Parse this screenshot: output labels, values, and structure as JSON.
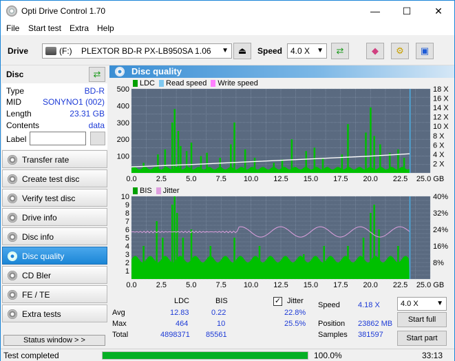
{
  "window": {
    "title": "Opti Drive Control 1.70",
    "minimize": "—",
    "maximize": "☐",
    "close": "✕"
  },
  "menu": [
    "File",
    "Start test",
    "Extra",
    "Help"
  ],
  "toolbar": {
    "drive_label": "Drive",
    "drive_letter": "(F:)",
    "drive_name": "PLEXTOR BD-R  PX-LB950SA 1.06",
    "speed_label": "Speed",
    "speed_value": "4.0 X"
  },
  "disc": {
    "header": "Disc",
    "rows": [
      {
        "label": "Type",
        "value": "BD-R"
      },
      {
        "label": "MID",
        "value": "SONYNO1 (002)"
      },
      {
        "label": "Length",
        "value": "23.31 GB"
      },
      {
        "label": "Contents",
        "value": "data"
      }
    ],
    "label_field": "Label",
    "label_value": ""
  },
  "nav": [
    {
      "label": "Transfer rate",
      "active": false
    },
    {
      "label": "Create test disc",
      "active": false
    },
    {
      "label": "Verify test disc",
      "active": false
    },
    {
      "label": "Drive info",
      "active": false
    },
    {
      "label": "Disc info",
      "active": false
    },
    {
      "label": "Disc quality",
      "active": true
    },
    {
      "label": "CD Bler",
      "active": false
    },
    {
      "label": "FE / TE",
      "active": false
    },
    {
      "label": "Extra tests",
      "active": false
    }
  ],
  "status_window_button": "Status window > >",
  "panel_title": "Disc quality",
  "chart_data": [
    {
      "type": "area",
      "legend": [
        "LDC",
        "Read speed",
        "Write speed"
      ],
      "colors": {
        "LDC": "#00c000",
        "Read speed": "#7ec8f0",
        "Write speed": "#ff80ff",
        "background": "#5a6a80",
        "grid": "#8a9ab0"
      },
      "y_left_ticks": [
        "500",
        "400",
        "300",
        "200",
        "100"
      ],
      "y_right_ticks": [
        "18 X",
        "16 X",
        "14 X",
        "12 X",
        "10 X",
        "8 X",
        "6 X",
        "4 X",
        "2 X"
      ],
      "x_ticks": [
        "0.0",
        "2.5",
        "5.0",
        "7.5",
        "10.0",
        "12.5",
        "15.0",
        "17.5",
        "20.0",
        "22.5",
        "25.0 GB"
      ],
      "xlim": [
        0,
        25
      ],
      "ylim": [
        0,
        500
      ],
      "y2lim": [
        0,
        18
      ],
      "end_position_gb": 23.31,
      "ldc_spikes": [
        [
          1.0,
          60
        ],
        [
          2.2,
          110
        ],
        [
          2.8,
          140
        ],
        [
          3.4,
          300
        ],
        [
          3.6,
          380
        ],
        [
          3.9,
          250
        ],
        [
          4.1,
          160
        ],
        [
          4.6,
          130
        ],
        [
          5.0,
          180
        ],
        [
          5.8,
          100
        ],
        [
          6.3,
          120
        ],
        [
          7.4,
          90
        ],
        [
          8.3,
          170
        ],
        [
          8.6,
          300
        ],
        [
          9.5,
          140
        ],
        [
          10.3,
          90
        ],
        [
          11.9,
          60
        ],
        [
          12.6,
          80
        ],
        [
          13.4,
          200
        ],
        [
          14.6,
          130
        ],
        [
          15.3,
          150
        ],
        [
          16.0,
          90
        ],
        [
          17.6,
          110
        ],
        [
          18.1,
          290
        ],
        [
          19.6,
          240
        ],
        [
          20.0,
          390
        ],
        [
          20.3,
          220
        ],
        [
          20.8,
          170
        ],
        [
          21.6,
          120
        ],
        [
          22.3,
          140
        ],
        [
          22.8,
          90
        ]
      ],
      "ldc_base": 20,
      "read_speed": [
        [
          0,
          1.3
        ],
        [
          5,
          1.8
        ],
        [
          10,
          2.4
        ],
        [
          15,
          3.0
        ],
        [
          20,
          3.6
        ],
        [
          23.3,
          4.1
        ]
      ]
    },
    {
      "type": "area",
      "legend": [
        "BIS",
        "Jitter"
      ],
      "colors": {
        "BIS": "#00c000",
        "Jitter": "#e0a0e0",
        "background": "#5a6a80",
        "grid": "#8a9ab0"
      },
      "y_left_ticks": [
        "10",
        "9",
        "8",
        "7",
        "6",
        "5",
        "4",
        "3",
        "2",
        "1"
      ],
      "y_right_ticks": [
        "40%",
        "32%",
        "24%",
        "16%",
        "8%"
      ],
      "x_ticks": [
        "0.0",
        "2.5",
        "5.0",
        "7.5",
        "10.0",
        "12.5",
        "15.0",
        "17.5",
        "20.0",
        "22.5",
        "25.0 GB"
      ],
      "xlim": [
        0,
        25
      ],
      "ylim": [
        0,
        10
      ],
      "y2lim": [
        0,
        40
      ],
      "bis_spikes": [
        [
          1.0,
          4
        ],
        [
          2.1,
          7
        ],
        [
          2.6,
          5
        ],
        [
          3.4,
          9
        ],
        [
          3.6,
          10
        ],
        [
          3.8,
          8
        ],
        [
          4.3,
          5
        ],
        [
          5.0,
          6
        ],
        [
          6.6,
          4
        ],
        [
          8.6,
          5
        ],
        [
          10.7,
          4
        ],
        [
          14.4,
          3
        ],
        [
          16.1,
          4
        ],
        [
          18.1,
          4
        ],
        [
          19.4,
          5
        ],
        [
          20.0,
          8
        ],
        [
          20.3,
          9
        ],
        [
          20.7,
          6
        ],
        [
          22.3,
          4
        ]
      ],
      "bis_base": 2,
      "jitter_avg": 22.8,
      "jitter_max": 25.5
    }
  ],
  "stats": {
    "col_ldc": "LDC",
    "col_bis": "BIS",
    "jitter_label": "Jitter",
    "jitter_checked": true,
    "rows": [
      {
        "label": "Avg",
        "ldc": "12.83",
        "bis": "0.22",
        "jitter": "22.8%"
      },
      {
        "label": "Max",
        "ldc": "464",
        "bis": "10",
        "jitter": "25.5%"
      },
      {
        "label": "Total",
        "ldc": "4898371",
        "bis": "85561",
        "jitter": ""
      }
    ],
    "speed_label": "Speed",
    "speed_value": "4.18 X",
    "position_label": "Position",
    "position_value": "23862 MB",
    "samples_label": "Samples",
    "samples_value": "381597",
    "speed_select": "4.0 X",
    "start_full": "Start full",
    "start_part": "Start part"
  },
  "statusbar": {
    "text": "Test completed",
    "progress_percent": 100,
    "progress_label": "100.0%",
    "elapsed": "33:13"
  }
}
